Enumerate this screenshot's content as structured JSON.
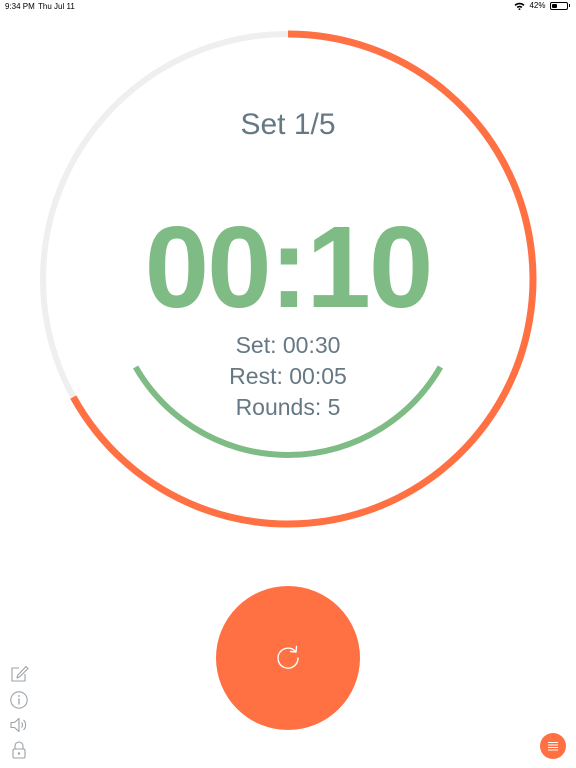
{
  "status_bar": {
    "time": "9:34 PM",
    "date": "Thu Jul 11",
    "battery": "42%",
    "battery_level": 0.42
  },
  "timer": {
    "set_title": "Set 1/5",
    "display": "00:10",
    "set_info": "Set: 00:30",
    "rest_info": "Rest: 00:05",
    "rounds_info": "Rounds: 5"
  },
  "progress": {
    "outer_fraction": 0.67,
    "inner_fraction": 0.33
  },
  "colors": {
    "accent": "#FF7043",
    "timer_green": "#7FBB85",
    "track_gray": "#EFEFEF",
    "text_gray": "#667884"
  },
  "icons": {
    "reset": "reset-icon",
    "edit": "edit-icon",
    "info": "info-icon",
    "sound": "sound-icon",
    "lock": "lock-icon",
    "list": "list-icon"
  }
}
